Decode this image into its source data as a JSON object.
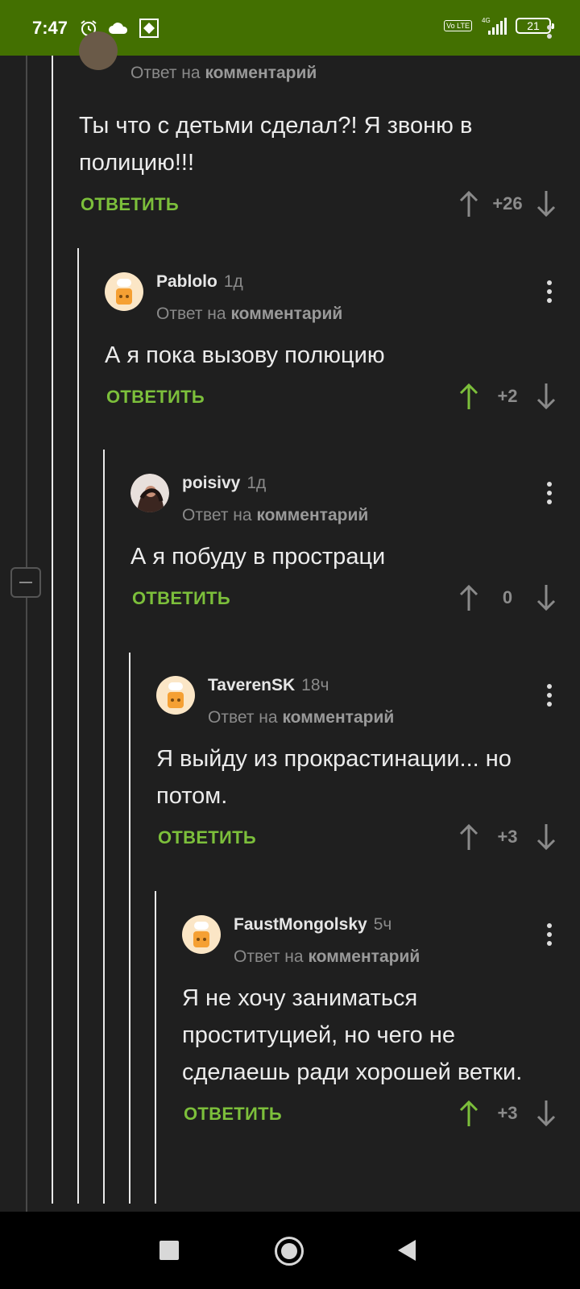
{
  "status_bar": {
    "time": "7:47",
    "battery": "21",
    "network": "4G",
    "volte": "Vo LTE"
  },
  "reply_prefix": "Ответ на",
  "reply_link": "комментарий",
  "reply_button": "ОТВЕТИТЬ",
  "comments": [
    {
      "author": "",
      "age": "",
      "text": "Ты что с детьми сделал?! Я звоню в полицию!!!",
      "score": "+26",
      "upvoted": false
    },
    {
      "author": "Pablolo",
      "age": "1д",
      "text": "А я пока вызову полюцию",
      "score": "+2",
      "upvoted": true
    },
    {
      "author": "poisivy",
      "age": "1д",
      "text": "А я побуду в простраци",
      "score": "0",
      "upvoted": false
    },
    {
      "author": "TaverenSK",
      "age": "18ч",
      "text": "Я выйду из прокрастинации... но потом.",
      "score": "+3",
      "upvoted": false
    },
    {
      "author": "FaustMongolsky",
      "age": "5ч",
      "text": "Я не хочу заниматься проституцией, но чего не сделаешь ради хорошей ветки.",
      "score": "+3",
      "upvoted": true
    }
  ],
  "colors": {
    "status_bar": "#437001",
    "accent_green": "#7cbf3b",
    "background": "#1f1f1f"
  }
}
